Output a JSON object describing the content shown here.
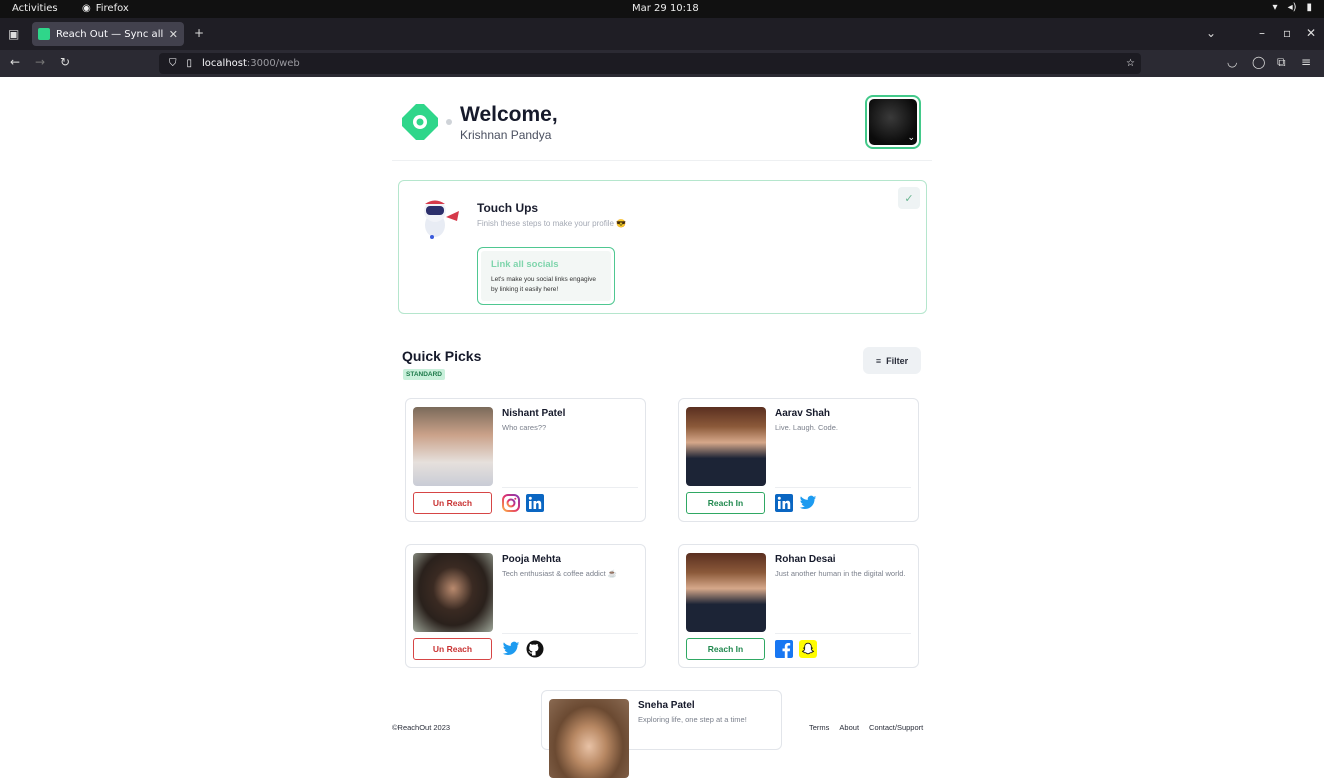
{
  "system_bar": {
    "activities": "Activities",
    "app": "Firefox",
    "clock": "Mar 29  10:18"
  },
  "browser": {
    "tab_title": "Reach Out — Sync all your",
    "url_host": "localhost",
    "url_rest": ":3000/web"
  },
  "header": {
    "welcome": "Welcome,",
    "user_name": "Krishnan Pandya"
  },
  "touch_ups": {
    "title": "Touch Ups",
    "subtitle": "Finish these steps to make your profile 😎",
    "task_title": "Link all socials",
    "task_desc": "Let's make you social links engagive by linking it easily here!"
  },
  "quick_picks": {
    "title": "Quick Picks",
    "badge": "STANDARD",
    "filter_label": "Filter"
  },
  "cards": [
    {
      "name": "Nishant Patel",
      "bio": "Who cares??",
      "action": "Un Reach",
      "socials": [
        "instagram-icon",
        "linkedin-icon"
      ]
    },
    {
      "name": "Aarav Shah",
      "bio": "Live. Laugh. Code.",
      "action": "Reach In",
      "socials": [
        "linkedin-icon",
        "twitter-icon"
      ]
    },
    {
      "name": "Pooja Mehta",
      "bio": "Tech enthusiast & coffee addict ☕",
      "action": "Un Reach",
      "socials": [
        "twitter-icon",
        "github-icon"
      ]
    },
    {
      "name": "Rohan Desai",
      "bio": "Just another human in the digital world.",
      "action": "Reach In",
      "socials": [
        "facebook-icon",
        "snapchat-icon"
      ]
    },
    {
      "name": "Sneha Patel",
      "bio": "Exploring life, one step at a time!"
    }
  ],
  "footer": {
    "copyright": "©ReachOut 2023",
    "terms": "Terms",
    "about": "About",
    "contact": "Contact/Support"
  },
  "colors": {
    "accent": "#2fd68a",
    "unreach": "#d64545",
    "reach": "#2fa863"
  }
}
